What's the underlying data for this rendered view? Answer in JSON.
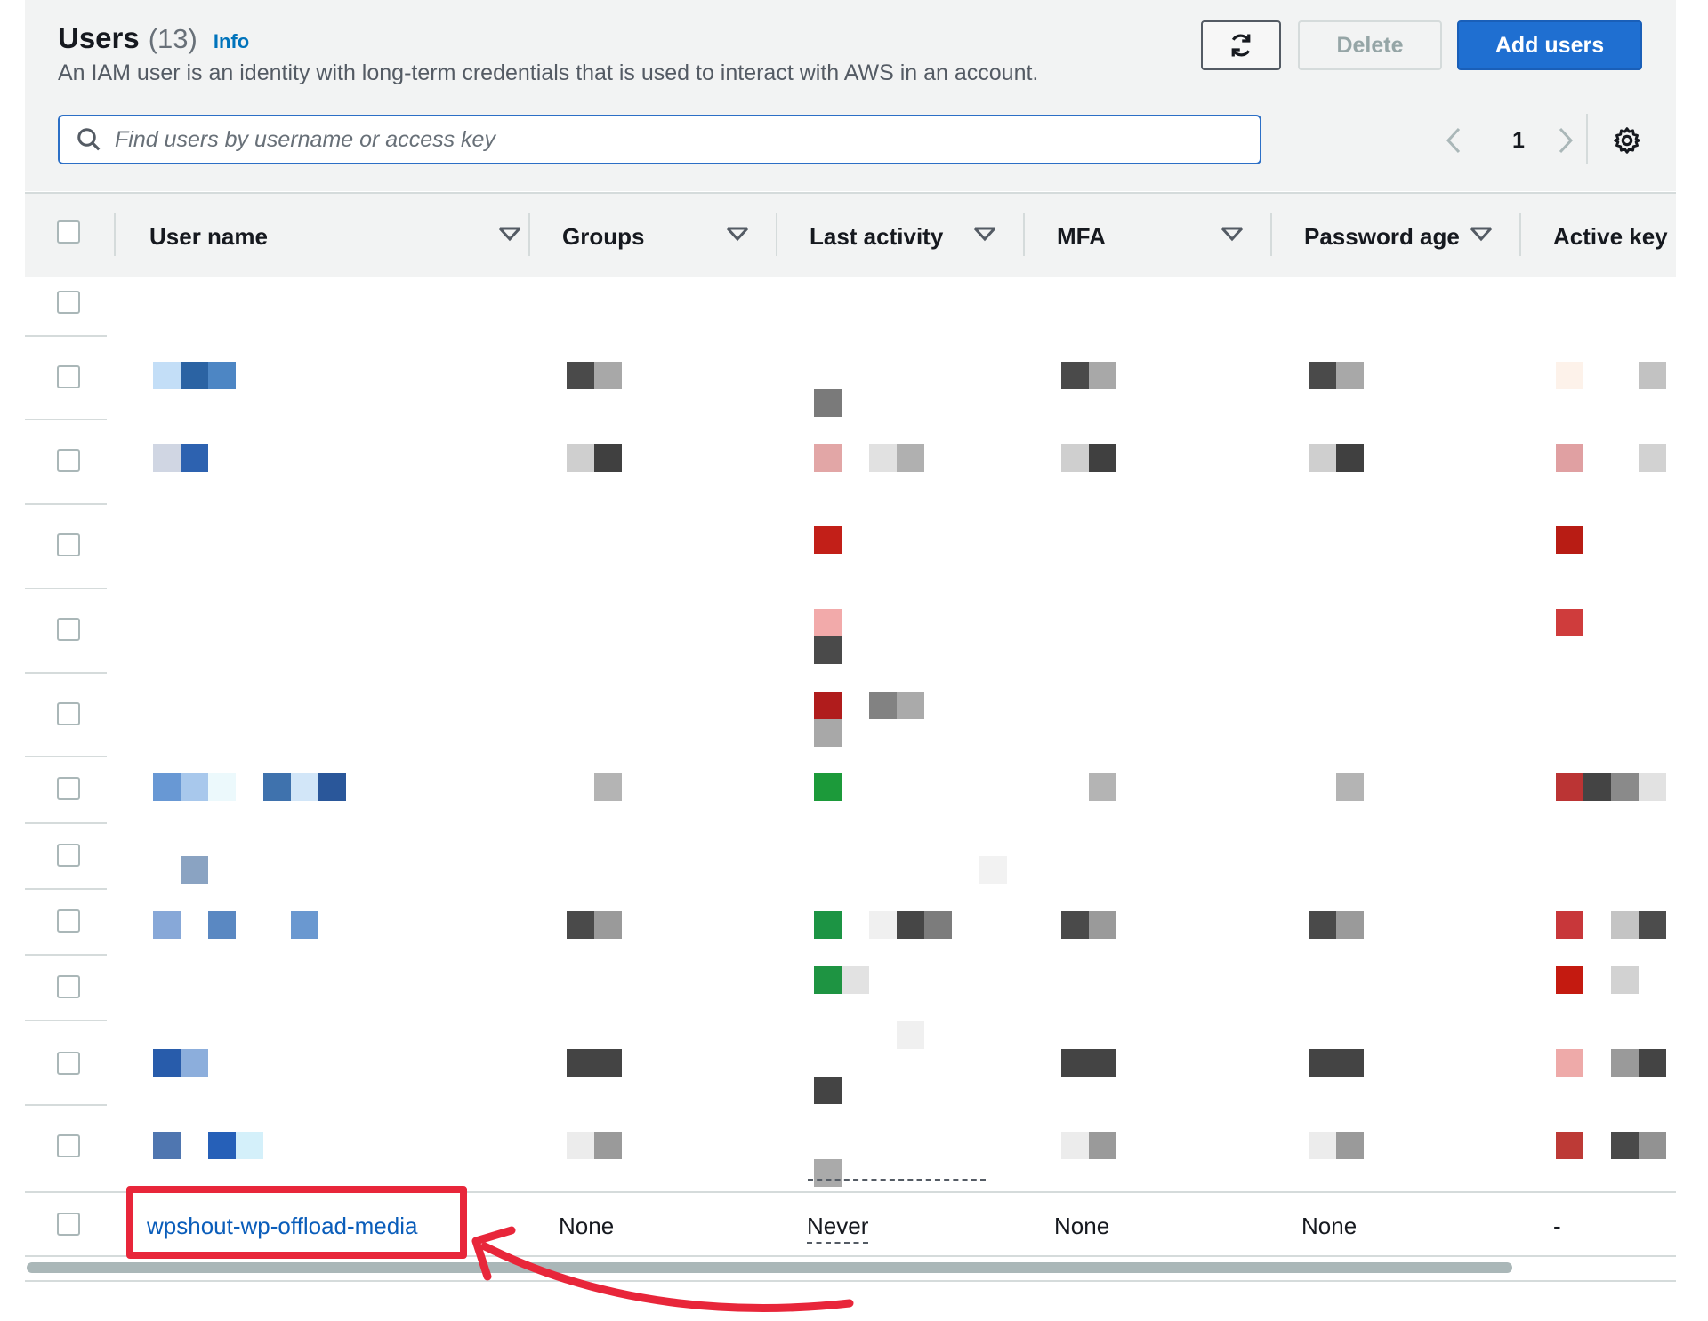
{
  "header": {
    "title": "Users",
    "count": "(13)",
    "info_link": "Info",
    "description": "An IAM user is an identity with long-term credentials that is used to interact with AWS in an account."
  },
  "toolbar": {
    "refresh_icon": "refresh-icon",
    "delete_label": "Delete",
    "add_label": "Add users"
  },
  "search": {
    "placeholder": "Find users by username or access key",
    "value": ""
  },
  "pagination": {
    "current_page": "1"
  },
  "table": {
    "columns": [
      "User name",
      "Groups",
      "Last activity",
      "MFA",
      "Password age",
      "Active key"
    ],
    "visible_row": {
      "user_name": "wpshout-wp-offload-media",
      "groups": "None",
      "last_activity": "Never",
      "mfa": "None",
      "password_age": "None",
      "active_key": "-"
    }
  },
  "colors": {
    "accent": "#1f6fd1",
    "link": "#0a5dba",
    "highlight": "#e8263a",
    "header_bg": "#f2f3f3"
  }
}
